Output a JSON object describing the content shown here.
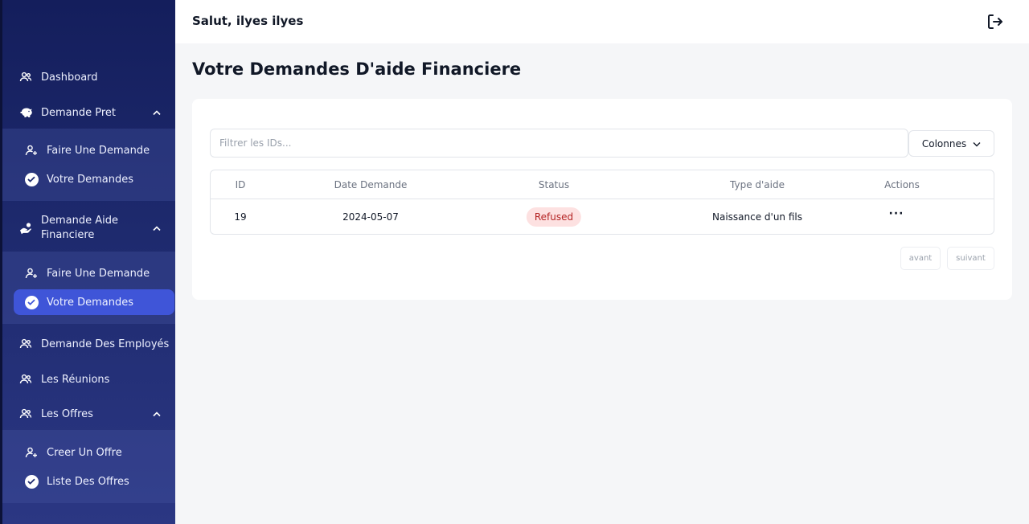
{
  "header": {
    "greeting": "Salut, ilyes ilyes"
  },
  "page": {
    "title": "Votre Demandes D'aide Financiere"
  },
  "sidebar": {
    "dashboard": "Dashboard",
    "demande_pret": {
      "label": "Demande Pret",
      "items": [
        "Faire Une Demande",
        "Votre Demandes"
      ]
    },
    "demande_aide": {
      "label_line1": "Demande Aide",
      "label_line2": "Financiere",
      "items": [
        "Faire Une Demande",
        "Votre Demandes"
      ]
    },
    "demande_employes": "Demande Des Employés",
    "reunions": "Les Réunions",
    "offres": {
      "label": "Les Offres",
      "items": [
        "Creer Un Offre",
        "Liste Des Offres"
      ]
    }
  },
  "filter": {
    "placeholder": "Filtrer les IDs..."
  },
  "columns_button": "Colonnes",
  "table": {
    "headers": [
      "ID",
      "Date Demande",
      "Status",
      "Type d'aide",
      "Actions"
    ],
    "rows": [
      {
        "id": "19",
        "date": "2024-05-07",
        "status": "Refused",
        "type": "Naissance d'un fils",
        "actions": "···"
      }
    ]
  },
  "pagination": {
    "prev": "avant",
    "next": "suivant"
  },
  "colors": {
    "sidebar_bg": "#1e2a6e",
    "active_item": "#3f55d8",
    "status_refused_bg": "#fde1e1",
    "status_refused_text": "#b42323"
  }
}
